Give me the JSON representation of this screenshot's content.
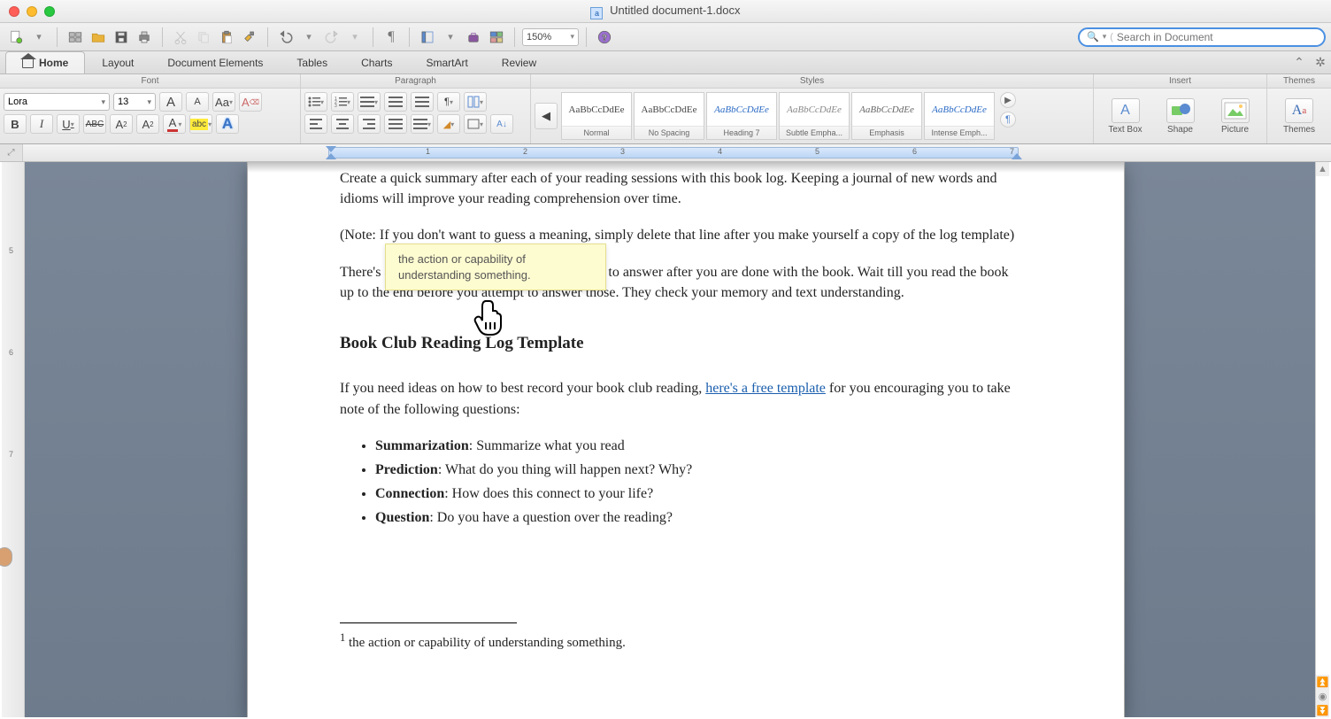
{
  "title": "Untitled document-1.docx",
  "zoom": "150%",
  "searchPlaceholder": "Search in Document",
  "tabs": [
    "Home",
    "Layout",
    "Document Elements",
    "Tables",
    "Charts",
    "SmartArt",
    "Review"
  ],
  "groups": {
    "font": "Font",
    "para": "Paragraph",
    "styles": "Styles",
    "insert": "Insert",
    "themes": "Themes"
  },
  "font": {
    "name": "Lora",
    "size": "13"
  },
  "fontBtns": {
    "growA": "A",
    "shrinkA": "A",
    "aa": "Aa",
    "clear": "A",
    "b": "B",
    "i": "I",
    "u": "U",
    "strike": "ABC",
    "sup": "A²",
    "sub": "A₂",
    "fcol": "A",
    "hcol": "abc",
    "tfx": "A"
  },
  "styles": [
    {
      "prev": "AaBbCcDdEe",
      "name": "Normal",
      "cls": ""
    },
    {
      "prev": "AaBbCcDdEe",
      "name": "No Spacing",
      "cls": ""
    },
    {
      "prev": "AaBbCcDdEe",
      "name": "Heading 7",
      "cls": "blue"
    },
    {
      "prev": "AaBbCcDdEe",
      "name": "Subtle Empha...",
      "cls": "italic"
    },
    {
      "prev": "AaBbCcDdEe",
      "name": "Emphasis",
      "cls": "emph"
    },
    {
      "prev": "AaBbCcDdEe",
      "name": "Intense Emph...",
      "cls": "blue"
    }
  ],
  "insert": {
    "textbox": "Text Box",
    "shape": "Shape",
    "picture": "Picture"
  },
  "themes": "Themes",
  "rulerNums": [
    "1",
    "2",
    "3",
    "4",
    "5",
    "6",
    "7"
  ],
  "doc": {
    "p1": "Create a quick summary after each of your reading sessions with this book log. Keeping a journal of new words and idioms will improve your reading comprehension over time.",
    "p2a": "(Note: If you don't want to guess a meaning, simply delete that line after you make yourself a copy of the log template)",
    "p3": "There's also a list of comprehension",
    "p3b": " questions to answer after you are done with the book. Wait till you read the book up to the end before you attempt to answer those. They check your memory and text understanding.",
    "h": "Book Club Reading Log Template",
    "p4a": "If you need ideas on how to best record your book club reading, ",
    "link": "here's a free template",
    "p4b": " for you encouraging you to take note of the following questions:",
    "li": [
      {
        "b": "Summarization",
        "t": ": Summarize what you read"
      },
      {
        "b": "Prediction",
        "t": ": What do you thing will happen next? Why?"
      },
      {
        "b": "Connection",
        "t": ": How does this connect to your life?"
      },
      {
        "b": "Question",
        "t": ": Do you have a question over the reading?"
      }
    ],
    "fn_marker": "1",
    "fn": " the action or capability of understanding something.",
    "tooltip": "the action or capability of understanding something."
  },
  "vrulerNums": [
    "5",
    "6",
    "7"
  ]
}
